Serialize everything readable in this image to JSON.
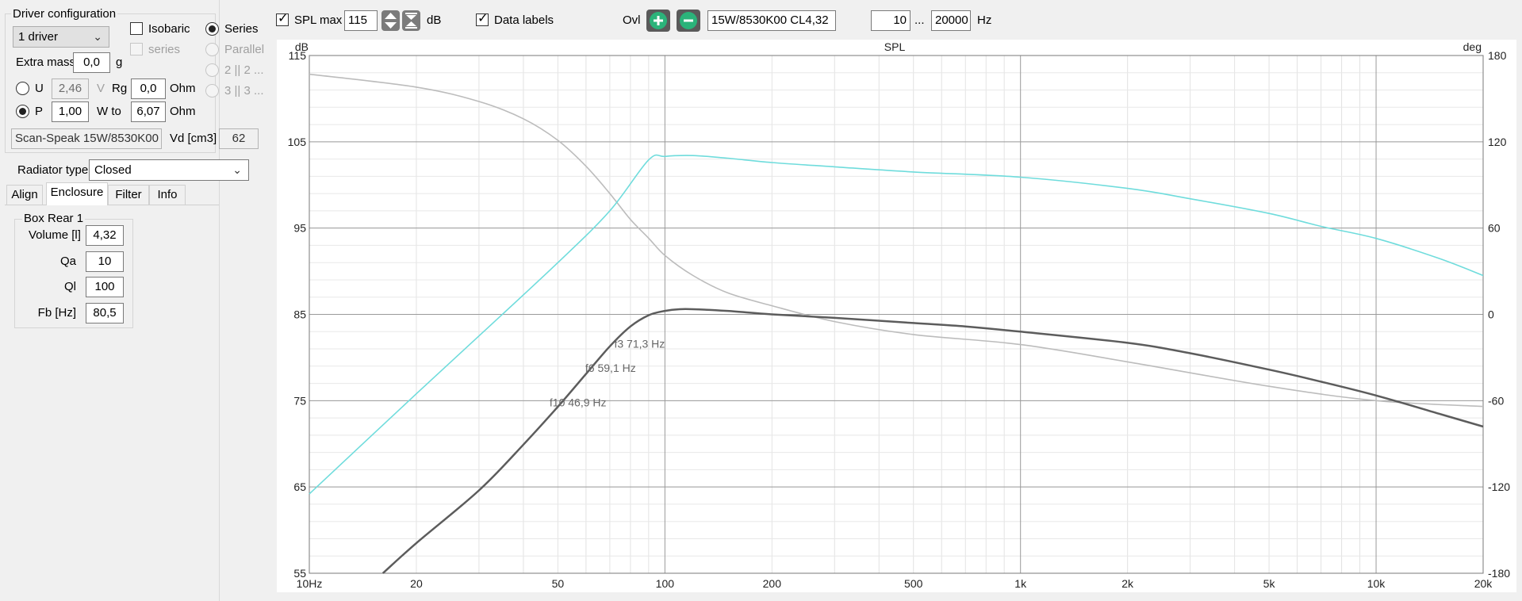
{
  "driver_config": {
    "title": "Driver configuration",
    "driver_count": "1 driver",
    "isobaric_label": "Isobaric",
    "series_sub_label": "series",
    "series_label": "Series",
    "parallel_label": "Parallel",
    "opt_2_label": "2 || 2 ...",
    "opt_3_label": "3 || 3 ...",
    "extra_mass_label": "Extra mass",
    "extra_mass_value": "0,0",
    "extra_mass_unit": "g",
    "u_label": "U",
    "u_value": "2,46",
    "u_unit": "V",
    "rg_label": "Rg",
    "rg_value": "0,0",
    "rg_unit": "Ohm",
    "p_label": "P",
    "p_value": "1,00",
    "wto_label": "W to",
    "wto_value": "6,07",
    "wto_unit": "Ohm",
    "driver_name": "Scan-Speak 15W/8530K00",
    "vd_label": "Vd [cm3]",
    "vd_value": "62"
  },
  "radiator": {
    "label": "Radiator type",
    "value": "Closed"
  },
  "tabs": [
    {
      "label": "Align"
    },
    {
      "label": "Enclosure"
    },
    {
      "label": "Filter"
    },
    {
      "label": "Info"
    }
  ],
  "enclosure": {
    "group_title": "Box Rear 1",
    "volume_label": "Volume [l]",
    "volume_value": "4,32",
    "qa_label": "Qa",
    "qa_value": "10",
    "ql_label": "Ql",
    "ql_value": "100",
    "fb_label": "Fb [Hz]",
    "fb_value": "80,5"
  },
  "toolbar": {
    "spl_max_label": "SPL max",
    "spl_max_value": "115",
    "spl_unit": "dB",
    "data_labels_label": "Data labels",
    "ovl_label": "Ovl",
    "overlay_name": "15W/8530K00 CL4,32",
    "freq_min": "10",
    "freq_sep": "...",
    "freq_max": "20000",
    "freq_unit": "Hz"
  },
  "colors": {
    "spl_curve": "#5c5c5c",
    "phase_curve": "#bcbcbc",
    "overlay_curve": "#6fdcdc",
    "add_button": "#2bb37a",
    "remove_button": "#2bb37a"
  },
  "chart_data": {
    "type": "line",
    "title": "SPL",
    "ylabel": "dB",
    "y2label": "deg",
    "x_scale": "log",
    "xlim": [
      10,
      20000
    ],
    "ylim": [
      55,
      115
    ],
    "y2lim": [
      -180,
      180
    ],
    "x_ticks": [
      {
        "v": 10,
        "label": "10Hz"
      },
      {
        "v": 20,
        "label": "20"
      },
      {
        "v": 50,
        "label": "50"
      },
      {
        "v": 100,
        "label": "100"
      },
      {
        "v": 200,
        "label": "200"
      },
      {
        "v": 500,
        "label": "500"
      },
      {
        "v": 1000,
        "label": "1k"
      },
      {
        "v": 2000,
        "label": "2k"
      },
      {
        "v": 5000,
        "label": "5k"
      },
      {
        "v": 10000,
        "label": "10k"
      },
      {
        "v": 20000,
        "label": "20k"
      }
    ],
    "y_ticks": [
      {
        "v": 115,
        "label": "115"
      },
      {
        "v": 105,
        "label": "105"
      },
      {
        "v": 95,
        "label": "95"
      },
      {
        "v": 85,
        "label": "85"
      },
      {
        "v": 75,
        "label": "75"
      },
      {
        "v": 65,
        "label": "65"
      },
      {
        "v": 55,
        "label": "55"
      }
    ],
    "y2_ticks": [
      {
        "v": 180,
        "label": "180"
      },
      {
        "v": 120,
        "label": "120"
      },
      {
        "v": 60,
        "label": "60"
      },
      {
        "v": 0,
        "label": "0"
      },
      {
        "v": -60,
        "label": "-60"
      },
      {
        "v": -120,
        "label": "-120"
      },
      {
        "v": -180,
        "label": "-180"
      }
    ],
    "grid": true,
    "series": [
      {
        "key": "spl",
        "axis": "left",
        "x": [
          16.1,
          20,
          30,
          40,
          50,
          60,
          70,
          80,
          90,
          100,
          110,
          120,
          150,
          200,
          300,
          500,
          700,
          1000,
          2000,
          3000,
          5000,
          7000,
          10000,
          15000,
          20000
        ],
        "y": [
          55,
          58.5,
          64.6,
          69.9,
          74.3,
          78.1,
          81.3,
          83.6,
          84.9,
          85.4,
          85.6,
          85.6,
          85.4,
          85.0,
          84.6,
          84.0,
          83.6,
          83.0,
          81.7,
          80.5,
          78.6,
          77.2,
          75.6,
          73.5,
          72.0
        ]
      },
      {
        "key": "phase",
        "axis": "right",
        "x": [
          10,
          20,
          30,
          40,
          50,
          60,
          70,
          80,
          90,
          100,
          120,
          150,
          200,
          300,
          500,
          1000,
          2000,
          5000,
          10000,
          20000
        ],
        "y": [
          167,
          158,
          148,
          136,
          121,
          103,
          84,
          66,
          53,
          41,
          27,
          15,
          6,
          -5,
          -14,
          -21,
          -33,
          -50,
          -60,
          -64
        ]
      },
      {
        "key": "overlay",
        "axis": "left",
        "x": [
          10,
          20,
          30,
          50,
          70,
          90,
          100,
          120,
          150,
          200,
          300,
          500,
          1000,
          2000,
          3000,
          5000,
          7000,
          10000,
          15000,
          20000
        ],
        "y": [
          64.2,
          75.8,
          82.5,
          91.0,
          97.0,
          102.9,
          103.3,
          103.4,
          103.1,
          102.6,
          102.1,
          101.5,
          100.9,
          99.6,
          98.4,
          96.7,
          95.2,
          93.8,
          91.5,
          89.5
        ]
      }
    ],
    "annotations": [
      {
        "text": "f3 71,3 Hz",
        "x": 71.3,
        "y": 81.6
      },
      {
        "text": "f6 59,1 Hz",
        "x": 59.1,
        "y": 78.8
      },
      {
        "text": "f10 46,9 Hz",
        "x": 46.9,
        "y": 74.8
      }
    ]
  }
}
